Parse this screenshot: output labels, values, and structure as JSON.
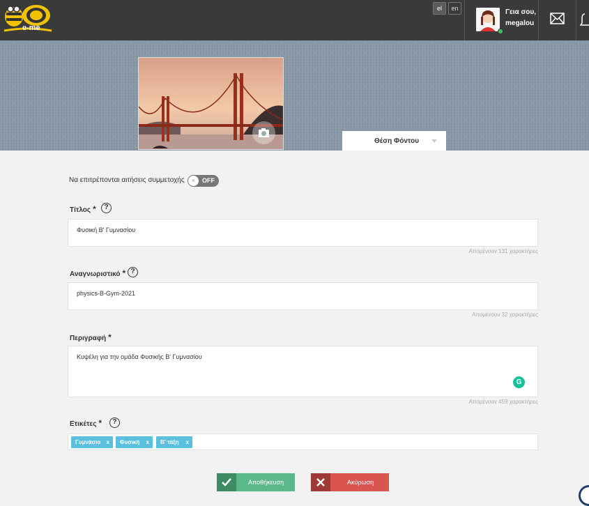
{
  "header": {
    "logo_text": "e-me",
    "languages": [
      "el",
      "en"
    ],
    "greeting_line1": "Γεια σου,",
    "greeting_line2": "megalou",
    "accent_color": "#3a3a3a"
  },
  "cover": {
    "background_position_label": "Θέση Φόντου",
    "camera_icon": "camera-icon"
  },
  "form": {
    "participation_label": "Να επιτρέπονται αιτήσεις συμμετοχής",
    "participation_state": "OFF",
    "title_label": "Τίτλος",
    "title_value": "Φυσική Β' Γυμνασίου",
    "title_counter": "Απομένουν 131 χαρακτήρες",
    "id_label": "Αναγνωριστικό",
    "id_value": "physics-B-Gym-2021",
    "id_counter": "Απομένουν 32 χαρακτήρες",
    "desc_label": "Περιγραφή",
    "desc_value": "Κυψέλη για την ομάδα Φυσικής Β' Γυμνασίου",
    "desc_counter": "Απομένουν 459 χαρακτήρες",
    "tags_label": "Ετικέτες",
    "tags": [
      "Γυμνάσιο",
      "Φυσική",
      "Β' τάξη"
    ],
    "tag_remove": "x",
    "required_mark": "*",
    "help_mark": "?"
  },
  "actions": {
    "save_label": "Αποθήκευση",
    "cancel_label": "Ακύρωση",
    "save_color": "#5cb88a",
    "cancel_color": "#d9534f"
  }
}
